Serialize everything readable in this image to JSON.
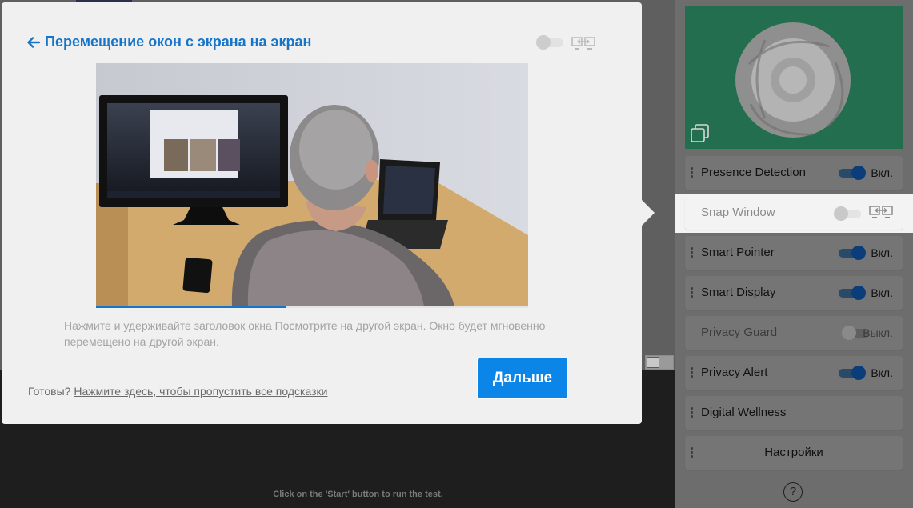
{
  "background": {
    "hint_text": "Click on the 'Start' button to run the test."
  },
  "side_panel": {
    "items": [
      {
        "label": "Presence Detection",
        "state": "Вкл."
      },
      {
        "label": "Snap Window"
      },
      {
        "label": "Smart Pointer",
        "state": "Вкл."
      },
      {
        "label": "Smart Display",
        "state": "Вкл."
      },
      {
        "label": "Privacy Guard",
        "state": "Выкл."
      },
      {
        "label": "Privacy Alert",
        "state": "Вкл."
      },
      {
        "label": "Digital Wellness"
      }
    ],
    "settings_label": "Настройки",
    "help_label": "?"
  },
  "dialog": {
    "title": "Перемещение окон с экрана на экран",
    "progress": 0.44,
    "description": "Нажмите и удерживайте заголовок окна Посмотрите на другой экран. Окно будет мгновенно перемещено на другой экран.",
    "ready_prefix": "Готовы?",
    "skip_link": "Нажмите здесь, чтобы пропустить все подсказки",
    "next_button": "Дальше"
  },
  "colors": {
    "accent": "#1775c9",
    "button": "#0b86e8",
    "panel_card": "#226e4e",
    "toggle_on": "#0b3d7a"
  }
}
